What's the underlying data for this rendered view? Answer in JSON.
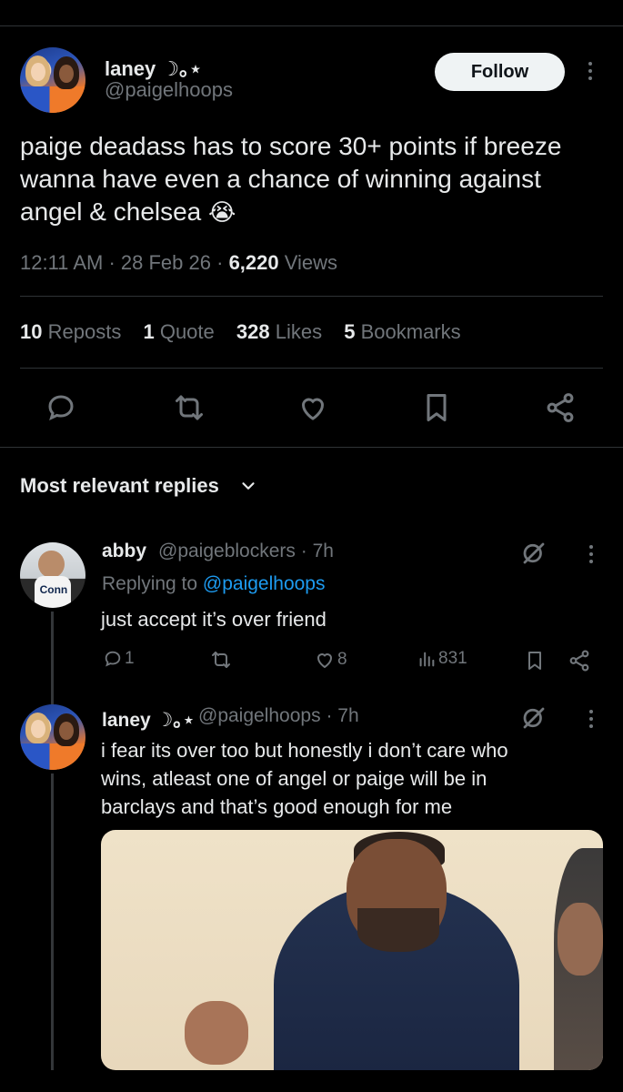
{
  "tweet": {
    "author_name": "laney ☽｡⋆",
    "author_handle": "@paigelhoops",
    "follow_label": "Follow",
    "text": "paige deadass has to score 30+ points if breeze wanna have even a chance of winning against angel & chelsea",
    "emoji": "😭",
    "time": "12:11 AM",
    "date": "28 Feb 26",
    "views_count": "6,220",
    "views_label": "Views"
  },
  "stats": {
    "reposts_count": "10",
    "reposts_label": "Reposts",
    "quotes_count": "1",
    "quotes_label": "Quote",
    "likes_count": "328",
    "likes_label": "Likes",
    "bookmarks_count": "5",
    "bookmarks_label": "Bookmarks"
  },
  "actions": [
    "reply-icon",
    "repost-icon",
    "like-icon",
    "bookmark-icon",
    "share-icon"
  ],
  "replies_header": "Most relevant replies",
  "replies": [
    {
      "name": "abby",
      "handle": "@paigeblockers",
      "time": "· 7h",
      "replying_prefix": "Replying to",
      "replying_handle": "@paigelhoops",
      "text": "just accept it’s over friend",
      "reply_count": "1",
      "like_count": "8",
      "views": "831"
    },
    {
      "name": "laney ☽｡⋆",
      "handle": "@paigelhoops",
      "time": "· 7h",
      "text_lines": [
        "i fear its over too but honestly i don’t care who",
        "wins, atleast one of angel or paige will be in",
        "barclays and that’s good enough for me"
      ]
    }
  ],
  "colors": {
    "background": "#000000",
    "text": "#e7e9ea",
    "muted": "#71767b",
    "link": "#1d9bf0",
    "divider": "#2f3336"
  }
}
